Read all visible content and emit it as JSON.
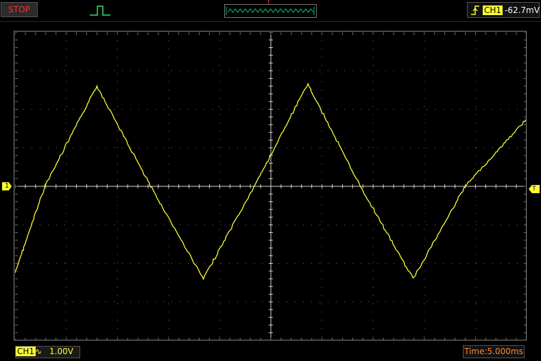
{
  "status": {
    "run_state": "STOP"
  },
  "trigger": {
    "channel": "CH1",
    "level": "-62.7mV",
    "marker": "T",
    "edge_icon": "rising-edge-icon"
  },
  "channel": {
    "name": "CH1",
    "marker": "1",
    "coupling_symbol": "∿",
    "scale": "1.00V",
    "color": "#ffff33"
  },
  "timebase": {
    "label": "Time:5.000ms"
  },
  "colors": {
    "grid": "#6f6f6f",
    "axis": "#d8d8d8",
    "stop_text": "#ff3030",
    "time_text": "#ff8a30",
    "overview_wave": "#00c878"
  },
  "chart_data": {
    "type": "line",
    "title": "",
    "xlabel": "",
    "ylabel": "",
    "x_range_ms": [
      -25,
      25
    ],
    "y_range_V": [
      -4,
      4
    ],
    "divisions": {
      "x": 10,
      "y": 8
    },
    "grid": true,
    "series": [
      {
        "waveform": "triangle",
        "x_ms": [
          -25,
          -22.1,
          -17.0,
          -11.75,
          -6.6,
          -1.6,
          3.6,
          8.75,
          13.9,
          19.0,
          25
        ],
        "y_V": [
          -2.25,
          0,
          2.6,
          0,
          -2.4,
          0,
          2.65,
          0,
          -2.4,
          0,
          1.75
        ]
      }
    ]
  }
}
